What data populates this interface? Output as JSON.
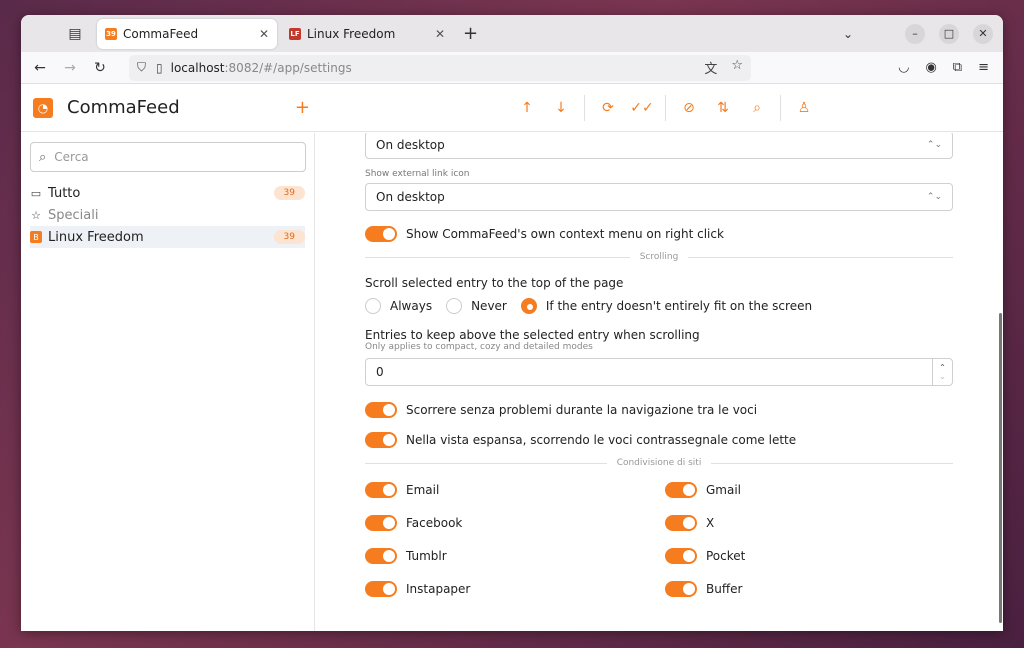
{
  "browser": {
    "tabs": [
      {
        "title": "CommaFeed",
        "active": true,
        "favicon_text": "39",
        "favicon_color": "#f57c1f"
      },
      {
        "title": "Linux Freedom",
        "active": false,
        "favicon_text": "LF",
        "favicon_color": "#c0392b"
      }
    ],
    "url_host": "localhost",
    "url_rest": ":8082/#/app/settings"
  },
  "app": {
    "name": "CommaFeed",
    "accent": "#f57c1f"
  },
  "sidebar": {
    "search_placeholder": "Cerca",
    "items": [
      {
        "label": "Tutto",
        "badge": "39",
        "icon": "inbox-icon"
      },
      {
        "label": "Speciali",
        "badge": "",
        "icon": "star-icon"
      },
      {
        "label": "Linux Freedom",
        "badge": "39",
        "icon": "feed-icon",
        "selected": true
      }
    ]
  },
  "settings": {
    "select1_value": "On desktop",
    "ext_link_label": "Show external link icon",
    "select2_value": "On desktop",
    "context_menu_label": "Show CommaFeed's own context menu on right click",
    "scrolling_divider": "Scrolling",
    "scroll_question": "Scroll selected entry to the top of the page",
    "scroll_options": [
      "Always",
      "Never",
      "If the entry doesn't entirely fit on the screen"
    ],
    "scroll_selected": 2,
    "entries_keep_label": "Entries to keep above the selected entry when scrolling",
    "entries_keep_sub": "Only applies to compact, cozy and detailed modes",
    "entries_keep_value": "0",
    "smooth_scroll_label": "Scorrere senza problemi durante la navigazione tra le voci",
    "mark_read_label": "Nella vista espansa, scorrendo le voci contrassegnale come lette",
    "sharing_divider": "Condivisione di siti",
    "sharing": [
      "Email",
      "Gmail",
      "Facebook",
      "X",
      "Tumblr",
      "Pocket",
      "Instapaper",
      "Buffer"
    ]
  }
}
